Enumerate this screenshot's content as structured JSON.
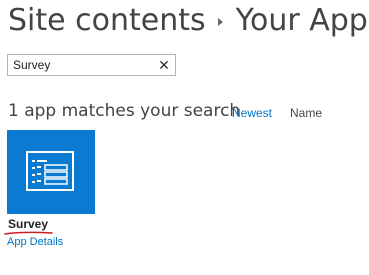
{
  "breadcrumb": {
    "parent": "Site contents",
    "current": "Your Apps"
  },
  "search": {
    "value": "Survey",
    "clear_icon": "close-icon"
  },
  "results": {
    "heading": "1 app matches your search",
    "sort_newest": "Newest",
    "sort_name": "Name"
  },
  "apps": [
    {
      "name": "Survey",
      "details_link": "App Details",
      "tile_color": "#0a7bd1",
      "icon": "survey-icon"
    }
  ],
  "colors": {
    "link": "#0072c6",
    "annotation": "#d21d1d"
  }
}
